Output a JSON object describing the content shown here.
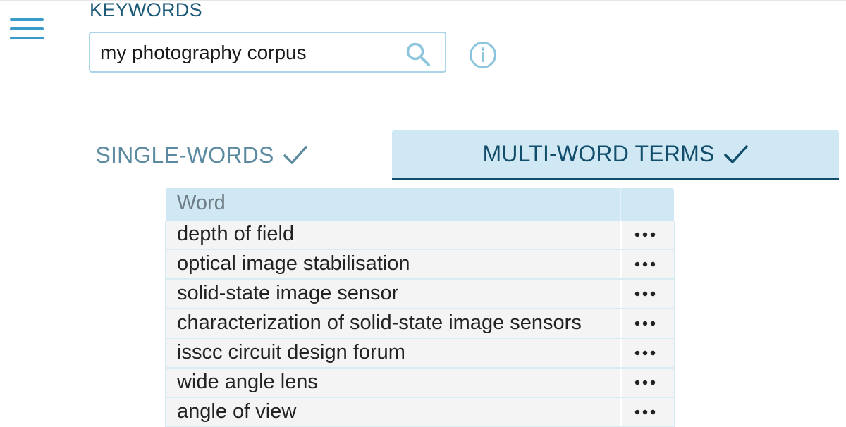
{
  "header": {
    "keywords_label": "KEYWORDS",
    "search_value": "my photography corpus",
    "search_placeholder": ""
  },
  "tabs": [
    {
      "label": "SINGLE-WORDS",
      "active": false,
      "checked": true
    },
    {
      "label": "MULTI-WORD TERMS",
      "active": true,
      "checked": true
    }
  ],
  "table": {
    "columns": [
      "Word"
    ],
    "rows": [
      "depth of field",
      "optical image stabilisation",
      "solid-state image sensor",
      "characterization of solid-state image sensors",
      "isscc circuit design forum",
      "wide angle lens",
      "angle of view"
    ]
  },
  "icons": {
    "menu": "hamburger-menu-icon",
    "search": "search-icon",
    "info": "info-icon",
    "check": "check-icon",
    "row_menu": "more-horizontal-icon"
  },
  "colors": {
    "accent": "#3a9bc9",
    "active_tab_bg": "#cfe8f3",
    "active_tab_text": "#124e6b",
    "inactive_tab_text": "#5b8aa0",
    "label_text": "#1d5a78"
  }
}
